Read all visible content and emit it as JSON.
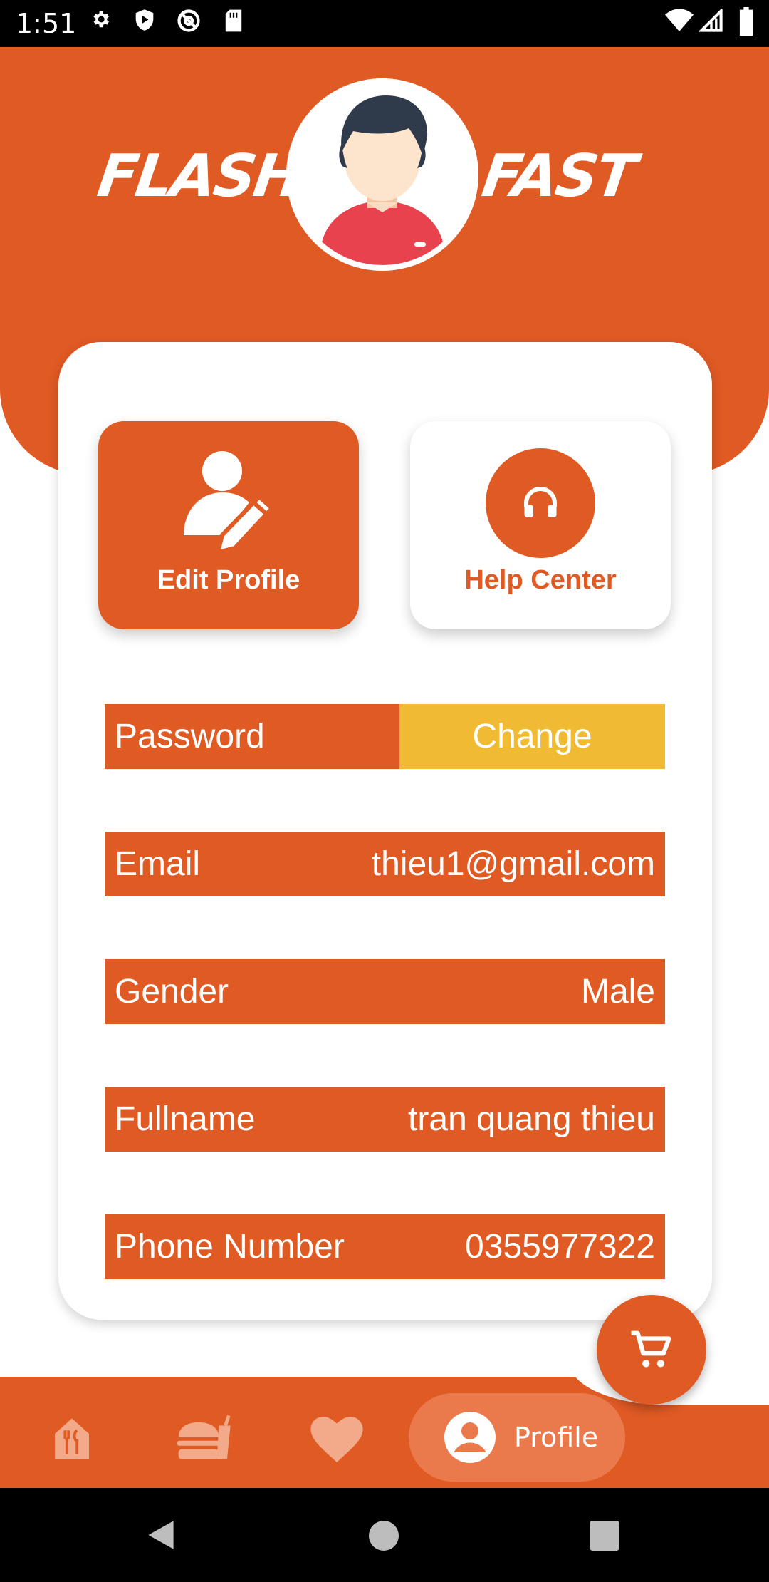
{
  "status_bar": {
    "time": "1:51",
    "left_icons": [
      "gear-icon",
      "shield-play-icon",
      "at-sign-icon",
      "sd-card-icon"
    ],
    "right_icons": [
      "wifi-icon",
      "signal-icon",
      "battery-icon"
    ]
  },
  "header": {
    "brand_left": "FLASH",
    "brand_right": "FAST",
    "avatar": "user-avatar"
  },
  "actions": {
    "edit_profile_label": "Edit Profile",
    "help_center_label": "Help Center"
  },
  "fields": {
    "password": {
      "label": "Password",
      "action": "Change"
    },
    "email": {
      "label": "Email",
      "value": "thieu1@gmail.com"
    },
    "gender": {
      "label": "Gender",
      "value": "Male"
    },
    "fullname": {
      "label": "Fullname",
      "value": "tran quang thieu"
    },
    "phone": {
      "label": "Phone Number",
      "value": "0355977322"
    }
  },
  "bottom_nav": {
    "items": [
      "home-icon",
      "food-icon",
      "heart-icon",
      "profile-icon"
    ],
    "active_label": "Profile"
  },
  "colors": {
    "primary": "#e05a24",
    "accent": "#f0bb33",
    "white": "#ffffff"
  }
}
